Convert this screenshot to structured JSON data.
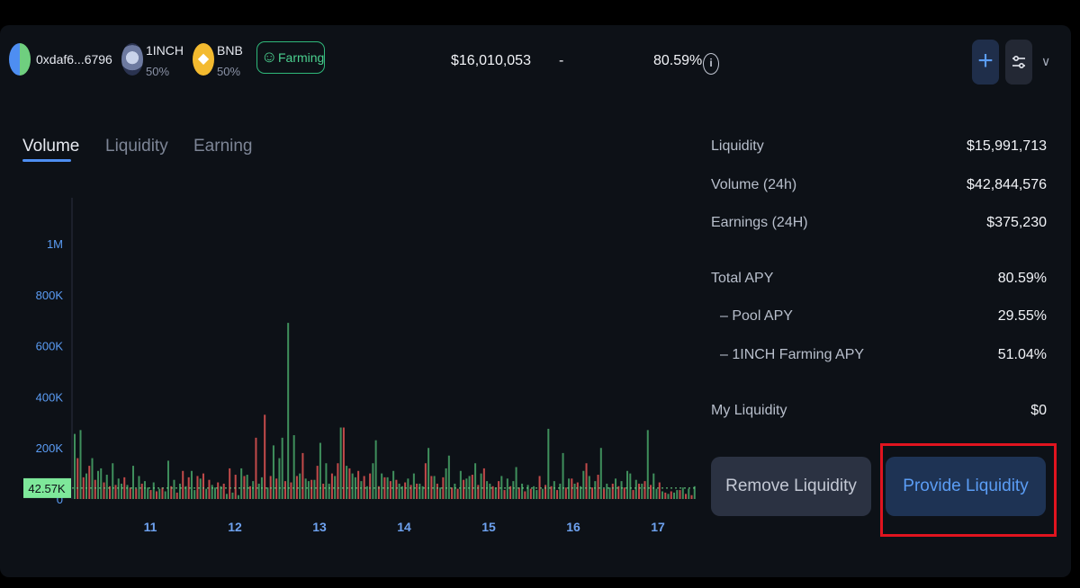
{
  "header": {
    "address": "0xdaf6...6796",
    "tokens": [
      {
        "name": "1INCH",
        "share": "50%",
        "icon": "1inch-token-icon"
      },
      {
        "name": "BNB",
        "share": "50%",
        "icon": "bnb-token-icon"
      }
    ],
    "farming_label": "Farming",
    "liquidity_value": "$16,010,053",
    "volume_value": "-",
    "apy_value": "80.59%",
    "info_glyph": "i",
    "plus_glyph": "+",
    "chevron_glyph": "∨",
    "bnb_glyph": "◆"
  },
  "tabs": [
    {
      "label": "Volume",
      "active": true
    },
    {
      "label": "Liquidity",
      "active": false
    },
    {
      "label": "Earning",
      "active": false
    }
  ],
  "stats": {
    "liquidity": {
      "label": "Liquidity",
      "value": "$15,991,713"
    },
    "volume": {
      "label": "Volume (24h)",
      "value": "$42,844,576"
    },
    "earnings": {
      "label": "Earnings (24H)",
      "value": "$375,230"
    },
    "total_apy": {
      "label": "Total APY",
      "value": "80.59%"
    },
    "pool_apy": {
      "label": "– Pool APY",
      "value": "29.55%"
    },
    "farming_apy": {
      "label": "–  1INCH Farming APY",
      "value": "51.04%"
    },
    "my_liquidity": {
      "label": "My Liquidity",
      "value": "$0"
    }
  },
  "buttons": {
    "remove": "Remove Liquidity",
    "provide": "Provide Liquidity"
  },
  "colors": {
    "up_bar": "#3f8f5c",
    "down_bar": "#c24a4a",
    "accent": "#4e8ef2",
    "highlight": "#e0141f"
  },
  "chart_data": {
    "type": "bar",
    "ytick_labels": [
      "0",
      "200K",
      "400K",
      "600K",
      "800K",
      "1M"
    ],
    "yticks": [
      0,
      200000,
      400000,
      600000,
      800000,
      1000000
    ],
    "ylim": [
      0,
      1180000
    ],
    "xtick_labels": [
      "11",
      "12",
      "13",
      "14",
      "15",
      "16",
      "17"
    ],
    "current_value_label": "42.57K",
    "current_value": 42570,
    "grid": false,
    "series_up": [
      255000,
      270000,
      100000,
      160000,
      110000,
      120000,
      95000,
      140000,
      80000,
      60000,
      55000,
      130000,
      90000,
      70000,
      45000,
      65000,
      40000,
      30000,
      150000,
      75000,
      60000,
      50000,
      110000,
      35000,
      80000,
      40000,
      55000,
      45000,
      50000,
      20000,
      25000,
      15000,
      120000,
      95000,
      70000,
      60000,
      85000,
      45000,
      210000,
      160000,
      240000,
      690000,
      250000,
      100000,
      80000,
      70000,
      75000,
      220000,
      140000,
      60000,
      90000,
      280000,
      130000,
      100000,
      85000,
      70000,
      50000,
      140000,
      230000,
      100000,
      85000,
      110000,
      60000,
      50000,
      80000,
      100000,
      60000,
      50000,
      200000,
      90000,
      45000,
      120000,
      170000,
      60000,
      110000,
      80000,
      90000,
      140000,
      100000,
      70000,
      60000,
      45000,
      90000,
      80000,
      70000,
      125000,
      60000,
      55000,
      50000,
      35000,
      40000,
      275000,
      70000,
      60000,
      180000,
      80000,
      60000,
      50000,
      110000,
      90000,
      70000,
      200000,
      60000,
      45000,
      80000,
      70000,
      110000,
      100000,
      75000,
      60000,
      270000,
      100000,
      40000,
      30000,
      20000,
      25000,
      35000,
      45000,
      40000,
      50000
    ],
    "series_down": [
      160000,
      85000,
      130000,
      75000,
      65000,
      50000,
      55000,
      85000,
      45000,
      40000,
      60000,
      35000,
      30000,
      45000,
      50000,
      25000,
      110000,
      85000,
      90000,
      100000,
      75000,
      65000,
      60000,
      120000,
      95000,
      90000,
      50000,
      240000,
      330000,
      90000,
      80000,
      70000,
      65000,
      90000,
      180000,
      75000,
      130000,
      60000,
      100000,
      140000,
      280000,
      120000,
      110000,
      90000,
      100000,
      50000,
      85000,
      70000,
      75000,
      65000,
      55000,
      60000,
      140000,
      90000,
      60000,
      85000,
      45000,
      40000,
      75000,
      95000,
      55000,
      120000,
      50000,
      70000,
      35000,
      50000,
      45000,
      30000,
      40000,
      90000,
      55000,
      50000,
      35000,
      45000,
      80000,
      65000,
      140000,
      45000,
      95000,
      40000,
      60000,
      50000,
      45000,
      35000,
      60000,
      70000,
      55000,
      65000,
      25000,
      30000,
      35000,
      20000,
      15000
    ]
  }
}
